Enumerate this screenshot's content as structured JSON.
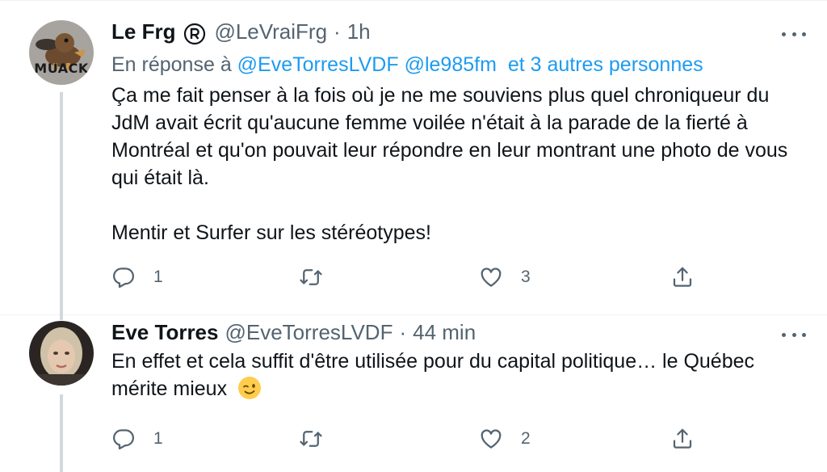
{
  "tweets": [
    {
      "author_name": "Le Frg",
      "handle": "@LeVraiFrg",
      "separator": "·",
      "time": "1h",
      "avatar_text": "MUACK",
      "reply_prefix": "En réponse à",
      "reply_mentions": "@EveTorresLVDF @le985fm",
      "reply_others": "et 3 autres personnes",
      "paragraphs": [
        "Ça me fait penser à la fois où je ne me souviens plus quel chroniqueur du JdM avait écrit qu'aucune femme voilée n'était à la parade de la fierté à Montréal et qu'on pouvait leur répondre en leur montrant une photo de vous qui était là.",
        "Mentir et Surfer sur les stéréotypes!"
      ],
      "reply_count": "1",
      "retweet_count": "",
      "like_count": "3"
    },
    {
      "author_name": "Eve Torres",
      "handle": "@EveTorresLVDF",
      "separator": "·",
      "time": "44 min",
      "text": "En effet et cela suffit d'être utilisée pour du capital politique… le Québec mérite mieux",
      "emoji": "winking-face",
      "reply_count": "1",
      "retweet_count": "",
      "like_count": "2"
    }
  ],
  "colors": {
    "link": "#1d9bf0",
    "secondary_text": "#536471",
    "primary_text": "#0f1419",
    "divider": "#eff3f4",
    "thread_line": "#cfd9de"
  }
}
